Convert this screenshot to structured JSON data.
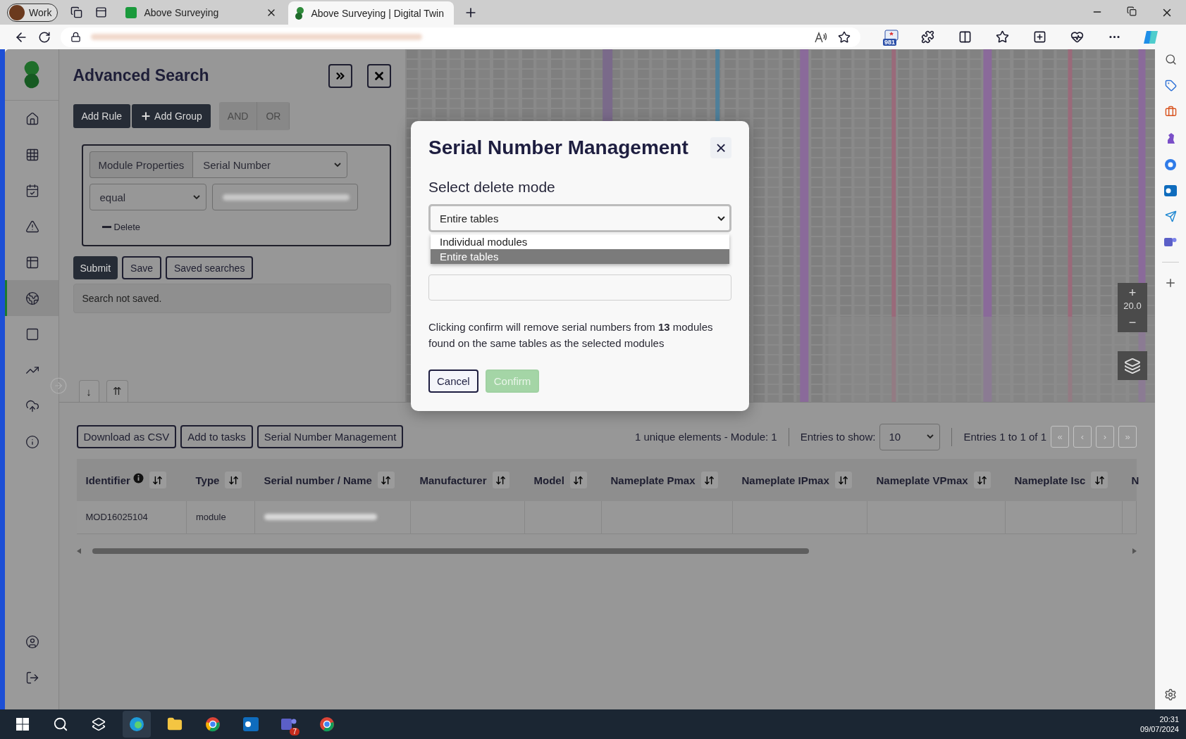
{
  "browser": {
    "profile": "Work",
    "tabs": [
      {
        "title": "Above Surveying",
        "selected": false
      },
      {
        "title": "Above Surveying | Digital Twin",
        "selected": true
      }
    ],
    "badge": "981"
  },
  "sidebar": {
    "items": [
      {
        "kind": "home",
        "selected": false
      },
      {
        "kind": "grid",
        "selected": false
      },
      {
        "kind": "calendar",
        "selected": false
      },
      {
        "kind": "warning",
        "selected": false
      },
      {
        "kind": "table",
        "selected": false
      },
      {
        "kind": "globe",
        "selected": true
      },
      {
        "kind": "frame",
        "selected": false
      },
      {
        "kind": "chart",
        "selected": false
      },
      {
        "kind": "cloud",
        "selected": false
      },
      {
        "kind": "info",
        "selected": false
      }
    ],
    "footer": [
      {
        "kind": "user"
      },
      {
        "kind": "logout"
      }
    ]
  },
  "search": {
    "title": "Advanced Search",
    "add_rule": "Add Rule",
    "add_group": "Add Group",
    "conjunction": {
      "disabled": true,
      "options": [
        "AND",
        "OR"
      ]
    },
    "rule": {
      "category": "Module Properties",
      "field": "Serial Number",
      "operator": "equal",
      "delete": "Delete"
    },
    "actions": [
      {
        "label": "Submit",
        "kind": "primary"
      },
      {
        "label": "Save",
        "kind": "outline"
      },
      {
        "label": "Saved searches",
        "kind": "outline"
      }
    ],
    "status": "Search not saved.",
    "panel_tabs": [
      "↓",
      "⇈"
    ]
  },
  "map": {
    "zoom_in": "+",
    "zoom": "20.0",
    "zoom_out": "−"
  },
  "modal": {
    "title": "Serial Number Management",
    "close": "×",
    "mode_label": "Select delete mode",
    "mode_value": "Entire tables",
    "mode_options": [
      {
        "label": "Individual modules",
        "selected": false
      },
      {
        "label": "Entire tables",
        "selected": true
      }
    ],
    "note": "Clicking confirm will remove serial numbers from **13** modules found on the same tables as the selected modules",
    "buttons": [
      {
        "label": "Cancel",
        "kind": "outline",
        "disabled": false
      },
      {
        "label": "Confirm",
        "kind": "success",
        "disabled": true
      }
    ]
  },
  "results": {
    "actions": [
      "Download as CSV",
      "Add to tasks",
      "Serial Number Management"
    ],
    "summary": "1 unique elements - Module: 1",
    "entries_label": "Entries to show:",
    "entries_value": "10",
    "range": "Entries 1 to 1 of 1",
    "pager": [
      "«",
      "‹",
      "›",
      "»"
    ],
    "columns": [
      "Identifier",
      "Type",
      "Serial number / Name",
      "Manufacturer",
      "Model",
      "Nameplate Pmax",
      "Nameplate IPmax",
      "Nameplate VPmax",
      "Nameplate Isc",
      "N"
    ],
    "rows": [
      {
        "cells": [
          "MOD16025104",
          "module",
          null,
          null,
          null,
          null,
          null,
          null,
          null,
          null
        ]
      }
    ]
  },
  "taskbar": {
    "time": "20:31",
    "date": "09/07/2024",
    "badge": "7"
  }
}
